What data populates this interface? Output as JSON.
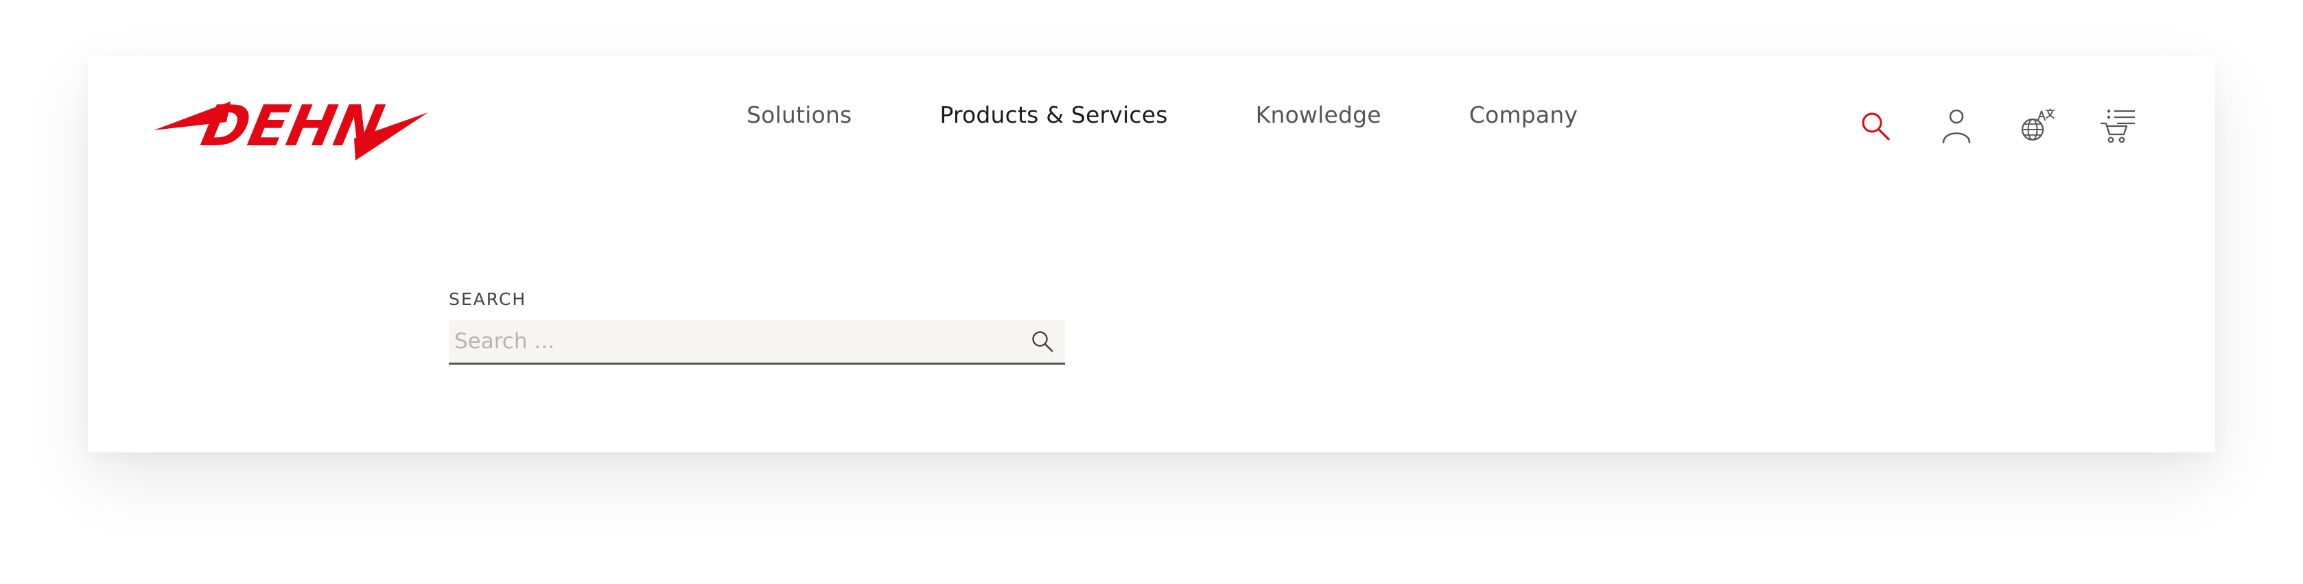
{
  "brand": {
    "logo_text": "DEHN",
    "logo_color": "#e30613"
  },
  "nav": {
    "items": [
      {
        "label": "Solutions",
        "active": false
      },
      {
        "label": "Products & Services",
        "active": true
      },
      {
        "label": "Knowledge",
        "active": false
      },
      {
        "label": "Company",
        "active": false
      }
    ]
  },
  "header_icons": [
    {
      "name": "search-icon",
      "color": "#e30613"
    },
    {
      "name": "user-icon",
      "color": "#555555"
    },
    {
      "name": "language-globe-icon",
      "color": "#555555"
    },
    {
      "name": "cart-list-icon",
      "color": "#555555"
    }
  ],
  "search": {
    "label": "SEARCH",
    "placeholder": "Search ...",
    "value": ""
  }
}
